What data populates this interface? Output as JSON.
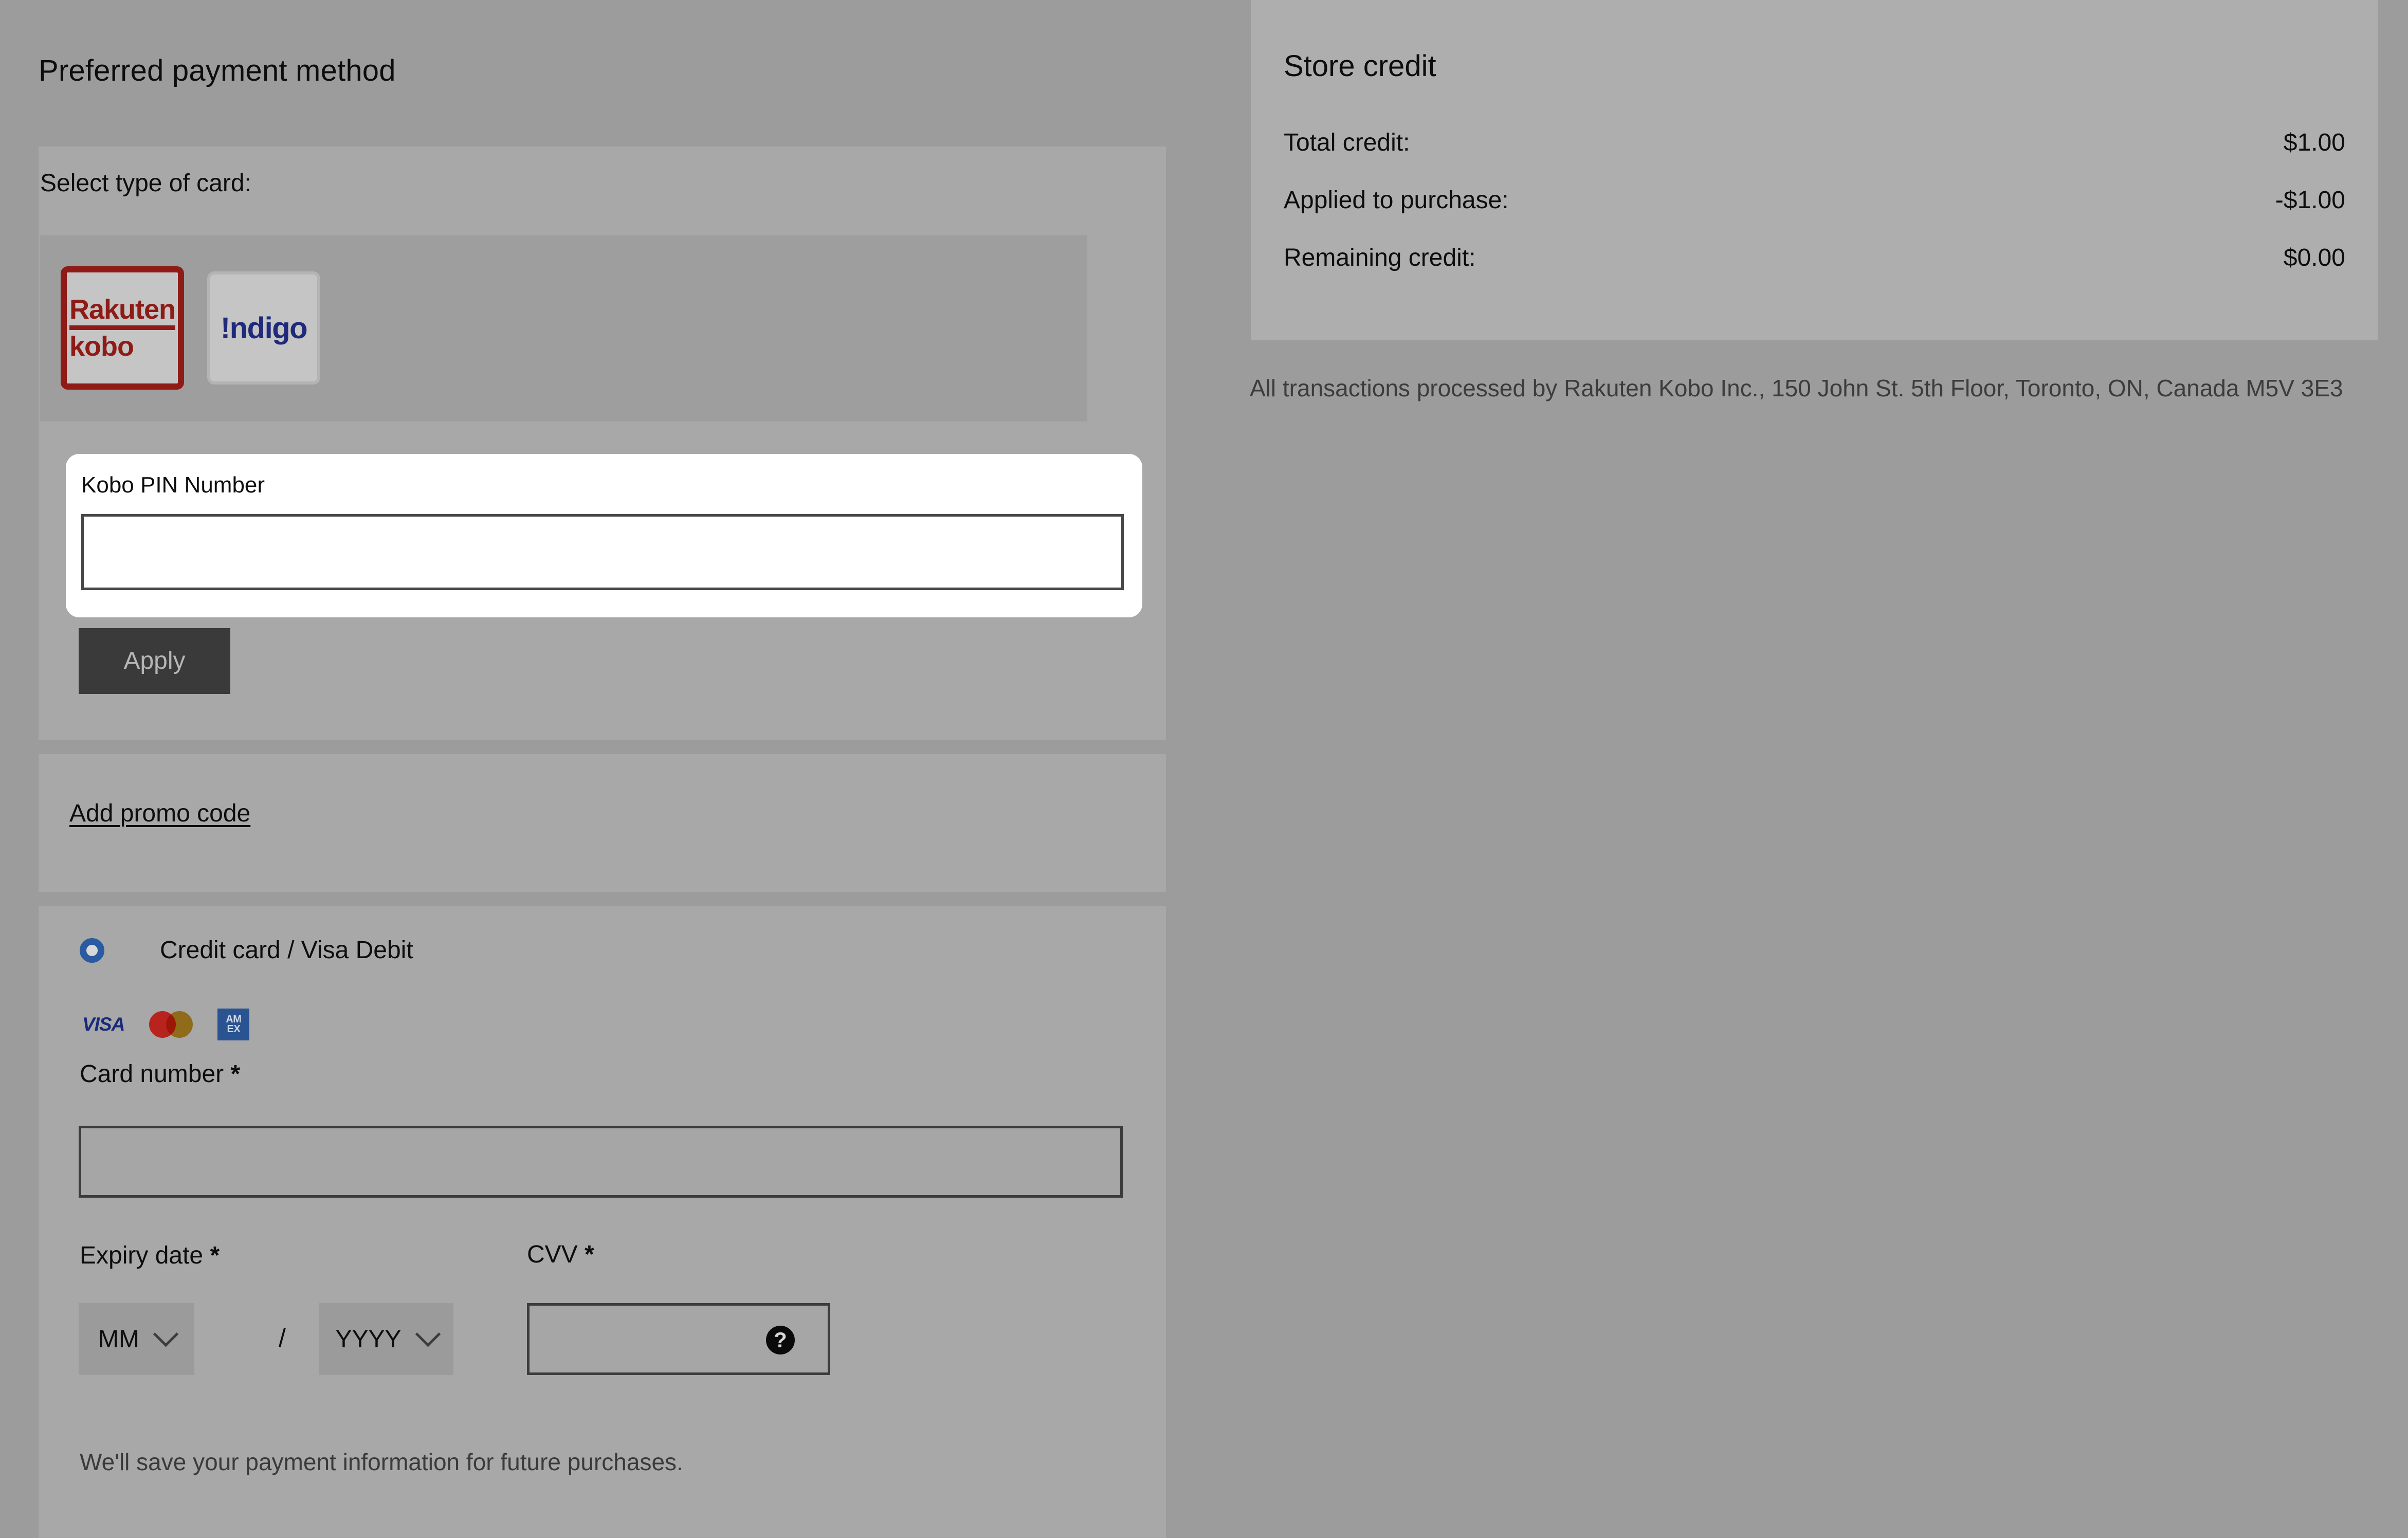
{
  "page": {
    "title": "Preferred payment method"
  },
  "card_type": {
    "label": "Select type of card:",
    "options": [
      {
        "name": "rakuten-kobo",
        "line1": "Rakuten",
        "line2": "kobo",
        "selected": true
      },
      {
        "name": "indigo",
        "line1": "!ndigo",
        "selected": false
      }
    ],
    "selected_border_color": "#8e1b16"
  },
  "kobo_pin": {
    "label": "Kobo PIN Number",
    "value": "",
    "placeholder": "",
    "apply_label": "Apply"
  },
  "promo": {
    "link_label": "Add promo code"
  },
  "credit_card": {
    "radio_label": "Credit card / Visa Debit",
    "radio_selected": true,
    "radio_color": "#2a5aa0",
    "accepted_brands": [
      {
        "name": "visa-icon",
        "label": "VISA"
      },
      {
        "name": "mastercard-icon",
        "label": "Mastercard"
      },
      {
        "name": "amex-icon",
        "label": "AMEX",
        "line1": "AM",
        "line2": "EX"
      }
    ],
    "card_number": {
      "label": "Card number",
      "required_marker": "*",
      "value": "",
      "placeholder": ""
    },
    "expiry": {
      "label": "Expiry date",
      "required_marker": "*",
      "month_value": "MM",
      "year_value": "YYYY",
      "separator": "/"
    },
    "cvv": {
      "label": "CVV",
      "required_marker": "*",
      "value": "",
      "placeholder": "",
      "help_icon_label": "?"
    },
    "save_note": "We'll save your payment information for future purchases."
  },
  "store_credit": {
    "title": "Store credit",
    "rows": [
      {
        "label": "Total credit:",
        "value": "$1.00"
      },
      {
        "label": "Applied to purchase:",
        "value": "-$1.00"
      },
      {
        "label": "Remaining credit:",
        "value": "$0.00"
      }
    ]
  },
  "legal": {
    "text": "All transactions processed by Rakuten Kobo Inc., 150 John St. 5th Floor, Toronto, ON, Canada M5V 3E3"
  }
}
